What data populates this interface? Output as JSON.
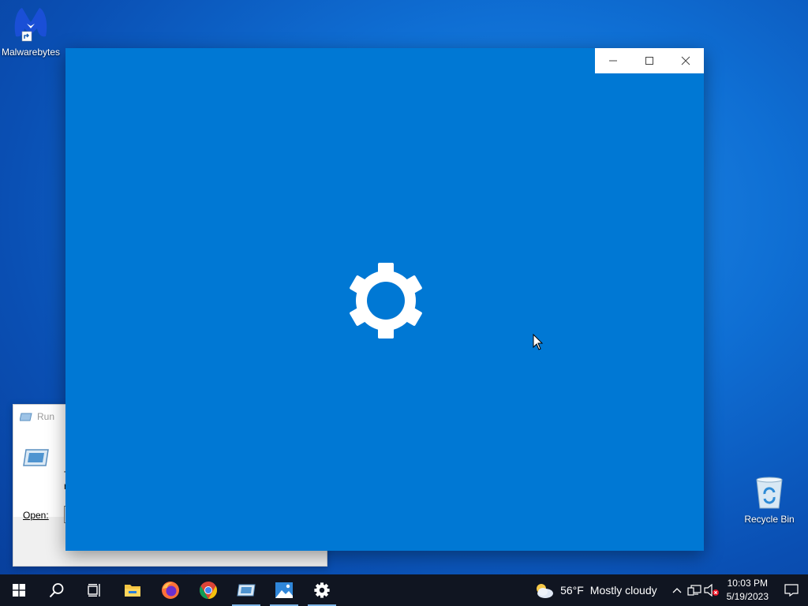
{
  "desktop": {
    "icons": [
      {
        "label": "Malwarebytes",
        "icon": "malwarebytes-icon"
      },
      {
        "label": "Recycle Bin",
        "icon": "recycle-bin-icon"
      }
    ]
  },
  "run_dialog": {
    "title": "Run",
    "open_label": "Open:",
    "description_fragment": "T\nr"
  },
  "settings_window": {
    "caption": {
      "minimize": "minimize-icon",
      "maximize": "maximize-icon",
      "close": "close-icon"
    },
    "splash_icon": "settings-gear-icon",
    "background_color": "#0078d4"
  },
  "taskbar": {
    "apps": [
      {
        "name": "start",
        "icon": "windows-logo-icon"
      },
      {
        "name": "search",
        "icon": "search-icon"
      },
      {
        "name": "task-view",
        "icon": "task-view-icon"
      },
      {
        "name": "file-explorer",
        "icon": "folder-icon"
      },
      {
        "name": "firefox",
        "icon": "firefox-icon"
      },
      {
        "name": "chrome",
        "icon": "chrome-icon"
      },
      {
        "name": "run",
        "icon": "run-icon"
      },
      {
        "name": "photos",
        "icon": "photos-icon"
      },
      {
        "name": "settings",
        "icon": "gear-icon"
      }
    ],
    "weather": {
      "temp": "56°F",
      "condition": "Mostly cloudy"
    },
    "clock": {
      "time": "10:03 PM",
      "date": "5/19/2023"
    }
  }
}
